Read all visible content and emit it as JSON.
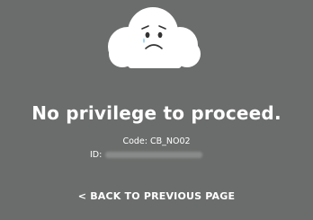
{
  "error": {
    "title": "No privilege to proceed.",
    "code_text": "Code: CB_NO02",
    "id_label": "ID:"
  },
  "actions": {
    "back_label": "< BACK TO PREVIOUS PAGE"
  },
  "icons": {
    "main": "sad-cloud-icon"
  },
  "colors": {
    "background": "#6b6d6c",
    "text": "#ffffff",
    "cloud": "#ffffff",
    "face": "#333333"
  }
}
